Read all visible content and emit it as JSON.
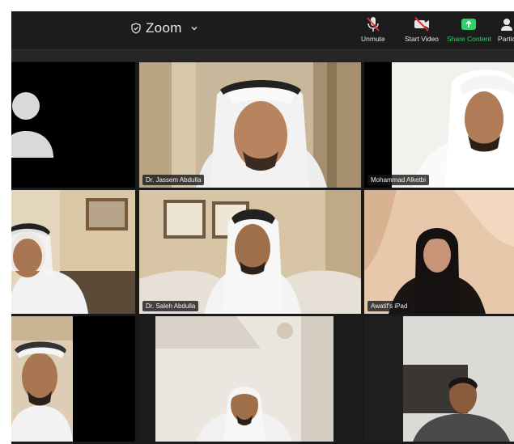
{
  "meeting": {
    "app_name": "Zoom",
    "icons": {
      "encryption": "shield-icon",
      "dropdown": "chevron-down-icon"
    }
  },
  "toolbar": {
    "unmute_label": "Unmute",
    "start_video_label": "Start Video",
    "share_content_label": "Share Content",
    "participants_label": "Partic",
    "accent_green": "#2fd06a"
  },
  "participants": [
    {
      "name": "",
      "video": "off"
    },
    {
      "name": "Dr. Jassem Abdulla",
      "video": "on"
    },
    {
      "name": "Mohammad Alketbi",
      "video": "on"
    },
    {
      "name": "",
      "video": "on"
    },
    {
      "name": "Dr. Saleh Abdulla",
      "video": "on"
    },
    {
      "name": "Awatif's iPad",
      "video": "on"
    },
    {
      "name": "",
      "video": "on",
      "active_speaker": true
    },
    {
      "name": "",
      "video": "on"
    },
    {
      "name": "",
      "video": "on"
    }
  ]
}
